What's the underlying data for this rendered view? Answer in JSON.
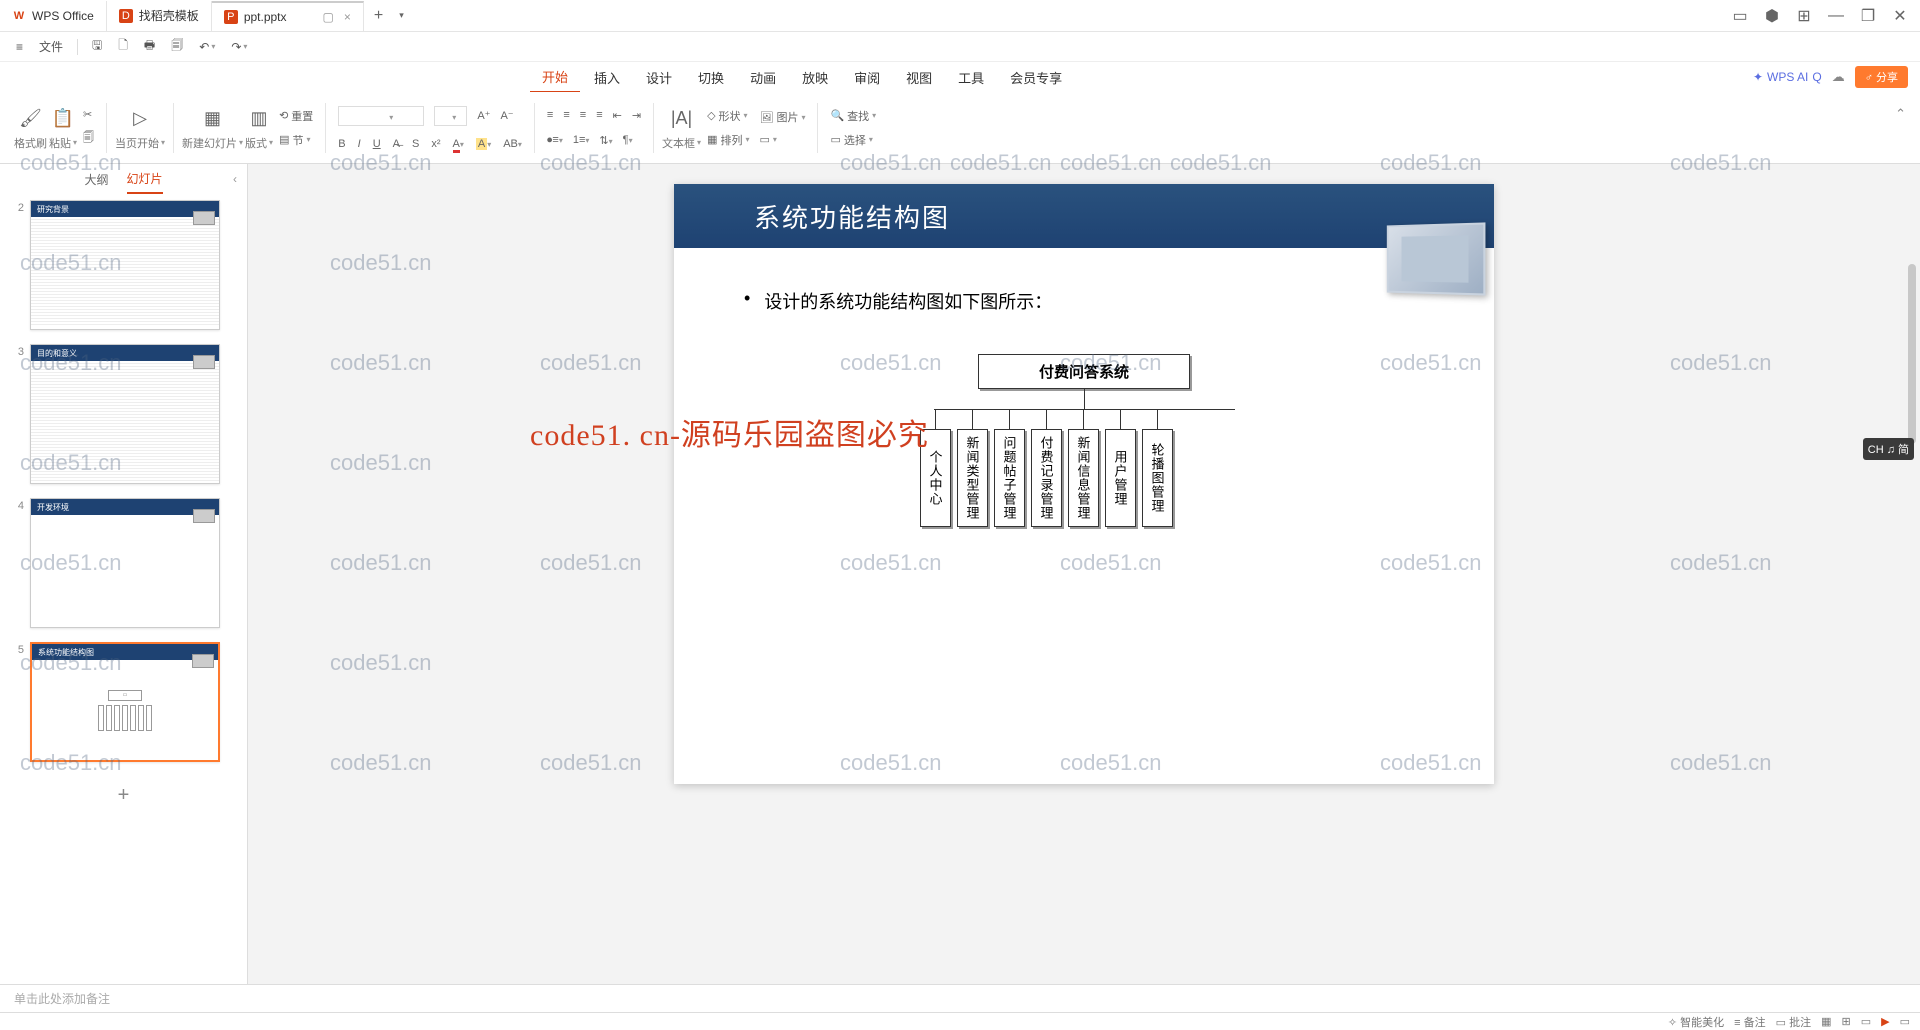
{
  "tabs": {
    "wps": "WPS Office",
    "template": "找稻壳模板",
    "file": "ppt.pptx"
  },
  "quickbar": {
    "menu": "≡",
    "file": "文件"
  },
  "menus": [
    "开始",
    "插入",
    "设计",
    "切换",
    "动画",
    "放映",
    "审阅",
    "视图",
    "工具",
    "会员专享"
  ],
  "ai": "WPS AI",
  "share": "分享",
  "ribbon": {
    "format_painter": "格式刷",
    "paste": "粘贴",
    "start_from": "当页开始",
    "new_slide": "新建幻灯片",
    "layout": "版式",
    "section": "节",
    "reset": "重置",
    "shapes": "形状",
    "picture": "图片",
    "textbox": "文本框",
    "arrange": "排列",
    "find": "查找",
    "select": "选择"
  },
  "sidepanel": {
    "outline": "大纲",
    "slides": "幻灯片"
  },
  "thumbs": [
    {
      "n": "2",
      "title": "研究背景"
    },
    {
      "n": "3",
      "title": "目的和意义"
    },
    {
      "n": "4",
      "title": "开发环境"
    },
    {
      "n": "5",
      "title": "系统功能结构图"
    }
  ],
  "slide": {
    "title": "系统功能结构图",
    "bullet": "设计的系统功能结构图如下图所示：",
    "root": "付费问答系统",
    "nodes": [
      "个人中心",
      "新闻类型管理",
      "问题帖子管理",
      "付费记录管理",
      "新闻信息管理",
      "用户管理",
      "轮播图管理"
    ]
  },
  "notes_placeholder": "单击此处添加备注",
  "watermark": "code51.cn",
  "watermark_red": "code51. cn-源码乐园盗图必究",
  "ime": "CH ♫ 简",
  "status": {
    "smart": "智能美化",
    "notes": "备注",
    "comments": "批注"
  },
  "chart_data": {
    "type": "tree",
    "title": "系统功能结构图",
    "root": "付费问答系统",
    "children": [
      "个人中心",
      "新闻类型管理",
      "问题帖子管理",
      "付费记录管理",
      "新闻信息管理",
      "用户管理",
      "轮播图管理"
    ]
  }
}
